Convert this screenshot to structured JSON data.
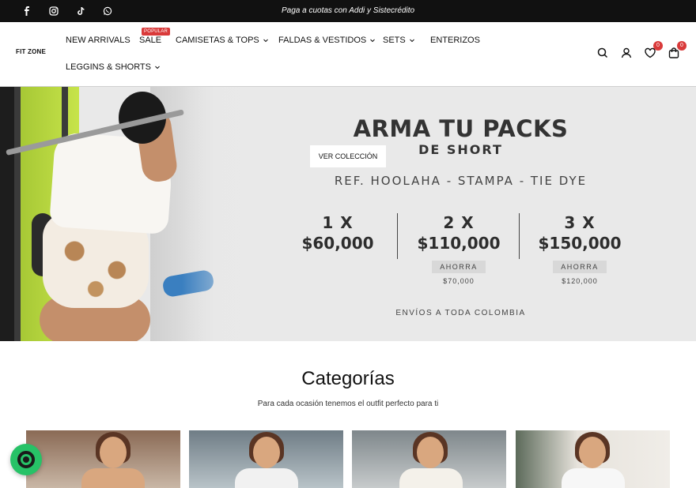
{
  "announcement": {
    "text": "Paga a cuotas con Addi y Sistecrédito",
    "social_icons": [
      "facebook-icon",
      "instagram-icon",
      "tiktok-icon",
      "whatsapp-icon"
    ]
  },
  "header": {
    "logo_text": "FIT ZONE",
    "popular_badge": "POPULAR",
    "nav": {
      "new_arrivals": "NEW ARRIVALS",
      "sale": "SALE",
      "camisetas": "CAMISETAS & TOPS",
      "faldas": "FALDAS & VESTIDOS",
      "sets": "SETS",
      "enterizos": "ENTERIZOS",
      "leggins": "LEGGINS & SHORTS"
    },
    "wishlist_count": "0",
    "cart_count": "0",
    "icons": [
      "search-icon",
      "account-icon",
      "heart-icon",
      "bag-icon"
    ]
  },
  "hero": {
    "title": "ARMA TU PACKS",
    "subtitle": "DE SHORT",
    "cta": "VER COLECCIÓN",
    "reference": "REF. HOOLAHA - STAMPA - TIE DYE",
    "packs": [
      {
        "qty": "1 X",
        "price": "$60,000"
      },
      {
        "qty": "2 X",
        "price": "$110,000",
        "save_label": "AHORRA",
        "save_amount": "$70,000"
      },
      {
        "qty": "3 X",
        "price": "$150,000",
        "save_label": "AHORRA",
        "save_amount": "$120,000"
      }
    ],
    "shipping": "ENVÍOS A TODA COLOMBIA"
  },
  "categories": {
    "title": "Categorías",
    "subtitle": "Para cada ocasión tenemos el outfit perfecto para ti"
  },
  "colors": {
    "topbar": "#111111",
    "accent_red": "#d93a3a",
    "hero_bg": "#e9e9e9",
    "chat_green": "#27c267"
  }
}
